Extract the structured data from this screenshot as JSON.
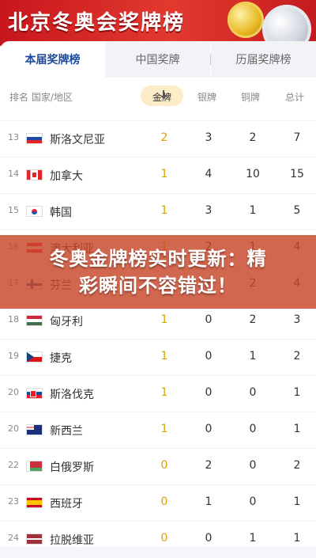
{
  "banner": {
    "title": "北京冬奥会奖牌榜"
  },
  "tabs": [
    {
      "label": "本届奖牌榜",
      "active": true
    },
    {
      "label": "中国奖牌",
      "active": false
    },
    {
      "label": "历届奖牌榜",
      "active": false
    }
  ],
  "columns": {
    "rank_country": "排名 国家/地区",
    "gold": "金牌",
    "silver": "银牌",
    "bronze": "铜牌",
    "total": "总计"
  },
  "rows": [
    {
      "rank": "13",
      "country": "斯洛文尼亚",
      "gold": "2",
      "silver": "3",
      "bronze": "2",
      "total": "7"
    },
    {
      "rank": "14",
      "country": "加拿大",
      "gold": "1",
      "silver": "4",
      "bronze": "10",
      "total": "15"
    },
    {
      "rank": "15",
      "country": "韩国",
      "gold": "1",
      "silver": "3",
      "bronze": "1",
      "total": "5"
    },
    {
      "rank": "16",
      "country": "澳大利亚",
      "gold": "1",
      "silver": "2",
      "bronze": "1",
      "total": "4"
    },
    {
      "rank": "17",
      "country": "芬兰",
      "gold": "1",
      "silver": "1",
      "bronze": "2",
      "total": "4"
    },
    {
      "rank": "18",
      "country": "匈牙利",
      "gold": "1",
      "silver": "0",
      "bronze": "2",
      "total": "3"
    },
    {
      "rank": "19",
      "country": "捷克",
      "gold": "1",
      "silver": "0",
      "bronze": "1",
      "total": "2"
    },
    {
      "rank": "20",
      "country": "斯洛伐克",
      "gold": "1",
      "silver": "0",
      "bronze": "0",
      "total": "1"
    },
    {
      "rank": "20",
      "country": "新西兰",
      "gold": "1",
      "silver": "0",
      "bronze": "0",
      "total": "1"
    },
    {
      "rank": "22",
      "country": "白俄罗斯",
      "gold": "0",
      "silver": "2",
      "bronze": "0",
      "total": "2"
    },
    {
      "rank": "23",
      "country": "西班牙",
      "gold": "0",
      "silver": "1",
      "bronze": "0",
      "total": "1"
    },
    {
      "rank": "24",
      "country": "拉脱维亚",
      "gold": "0",
      "silver": "0",
      "bronze": "1",
      "total": "1"
    }
  ],
  "overlay": {
    "line1": "冬奥金牌榜实时更新：精",
    "line2": "彩瞬间不容错过！"
  }
}
